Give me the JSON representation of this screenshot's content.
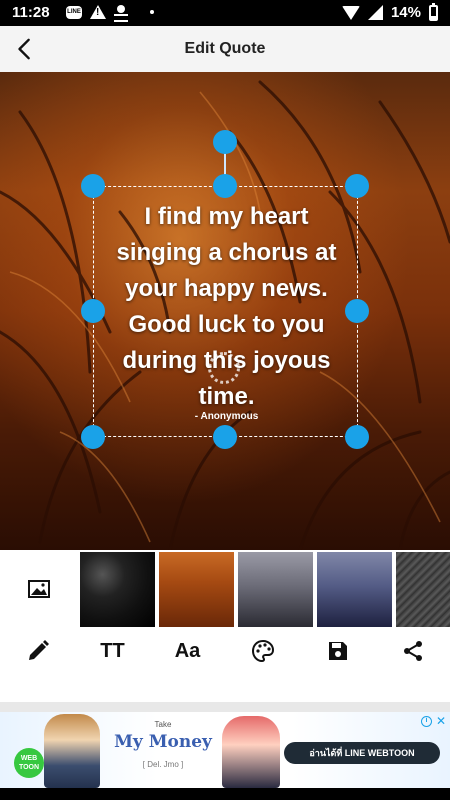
{
  "status_bar": {
    "time": "11:28",
    "line_app_label": "LINE",
    "battery_percent": "14%"
  },
  "app_bar": {
    "title": "Edit Quote",
    "back_icon": "arrow-back-icon"
  },
  "quote": {
    "lines": [
      "I find my heart",
      "singing a chorus at",
      "your happy news.",
      "Good luck to you",
      "during this joyous",
      "time."
    ],
    "author": "- Anonymous"
  },
  "background_thumbnails": [
    "dark-texture",
    "orange-grass",
    "misty-trees",
    "blue-mountains",
    "grey-fabric"
  ],
  "tools": [
    {
      "name": "edit-pencil-icon"
    },
    {
      "name": "text-size-icon",
      "label": "TT"
    },
    {
      "name": "font-icon",
      "label": "Aa"
    },
    {
      "name": "palette-icon"
    },
    {
      "name": "save-icon"
    },
    {
      "name": "share-icon"
    }
  ],
  "ad": {
    "small_text": "Take",
    "title": "My Money",
    "subtitle": "[ Del. Jmo ]",
    "badge": "WEB TOON",
    "cta": "อ่านได้ที่ LINE WEBTOON"
  },
  "colors": {
    "handle": "#1aa2e8",
    "app_bar": "#f4f4f4",
    "canvas_primary": "#8c3f10"
  }
}
